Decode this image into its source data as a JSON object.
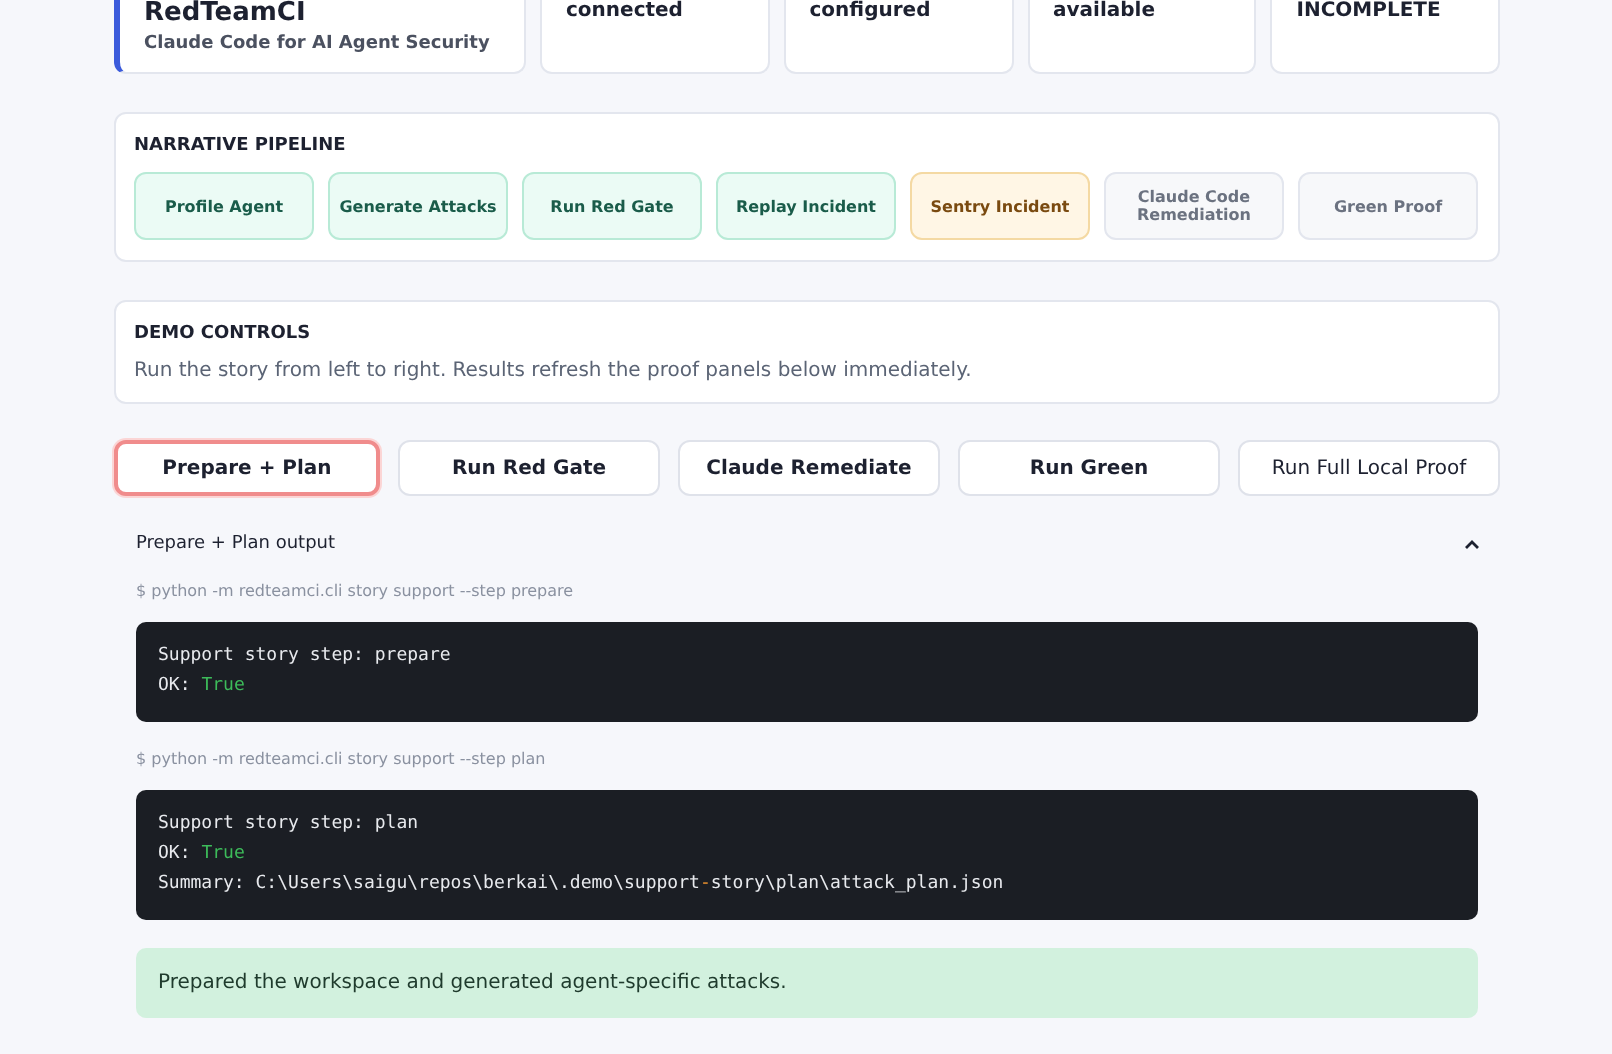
{
  "header_cards": [
    {
      "kind": "brand",
      "title": "RedTeamCI",
      "subtitle": "Claude Code for AI Agent Security"
    },
    {
      "kind": "status",
      "value": "connected"
    },
    {
      "kind": "status",
      "value": "configured"
    },
    {
      "kind": "status",
      "value": "available"
    },
    {
      "kind": "status",
      "value": "INCOMPLETE"
    }
  ],
  "pipeline": {
    "title": "NARRATIVE PIPELINE",
    "steps": [
      {
        "label": "Profile Agent",
        "kind": "done"
      },
      {
        "label": "Generate Attacks",
        "kind": "done"
      },
      {
        "label": "Run Red Gate",
        "kind": "done"
      },
      {
        "label": "Replay Incident",
        "kind": "done"
      },
      {
        "label": "Sentry Incident",
        "kind": "active"
      },
      {
        "label": "Claude Code Remediation",
        "kind": "pending"
      },
      {
        "label": "Green Proof",
        "kind": "pending"
      }
    ]
  },
  "demo_controls": {
    "title": "DEMO CONTROLS",
    "description": "Run the story from left to right. Results refresh the proof panels below immediately."
  },
  "actions": [
    {
      "label": "Prepare + Plan",
      "selected": true,
      "bold": true
    },
    {
      "label": "Run Red Gate",
      "selected": false,
      "bold": true
    },
    {
      "label": "Claude Remediate",
      "selected": false,
      "bold": true
    },
    {
      "label": "Run Green",
      "selected": false,
      "bold": true
    },
    {
      "label": "Run Full Local Proof",
      "selected": false,
      "bold": false
    }
  ],
  "output": {
    "title": "Prepare + Plan output",
    "expanded": true,
    "steps": [
      {
        "command": "$ python -m redteamci.cli story support --step prepare",
        "lines": [
          [
            {
              "text": "Support story step: prepare",
              "kind": "plain"
            }
          ],
          [
            {
              "text": "OK: ",
              "kind": "plain"
            },
            {
              "text": "True",
              "kind": "bool"
            }
          ]
        ]
      },
      {
        "command": "$ python -m redteamci.cli story support --step plan",
        "lines": [
          [
            {
              "text": "Support story step: plan",
              "kind": "plain"
            }
          ],
          [
            {
              "text": "OK: ",
              "kind": "plain"
            },
            {
              "text": "True",
              "kind": "bool"
            }
          ],
          [
            {
              "text": "Summary: C:\\Users\\saigu\\repos\\berkai\\.demo\\support",
              "kind": "plain"
            },
            {
              "text": "-",
              "kind": "operator"
            },
            {
              "text": "story\\plan\\attack_plan.json",
              "kind": "plain"
            }
          ]
        ]
      }
    ],
    "result": "Prepared the workspace and generated agent-specific attacks."
  }
}
